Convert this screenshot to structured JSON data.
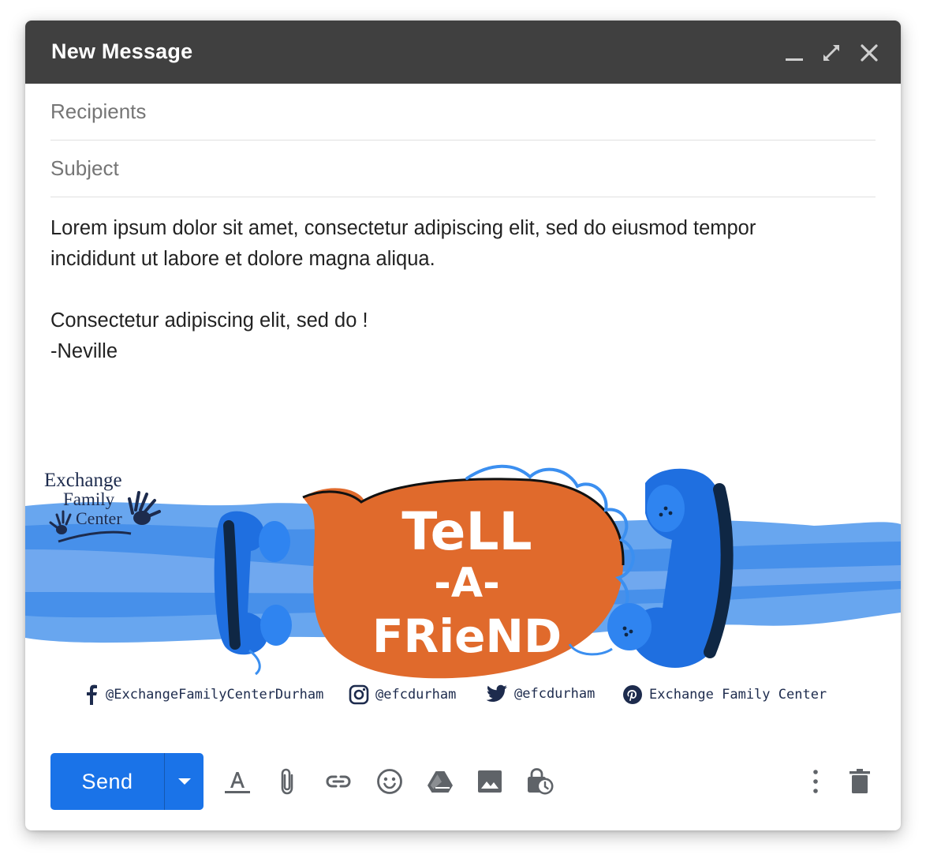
{
  "window": {
    "title": "New Message",
    "controls": [
      "minimize-icon",
      "expand-icon",
      "close-icon"
    ]
  },
  "recipients": {
    "placeholder": "Recipients"
  },
  "subject": {
    "placeholder": "Subject"
  },
  "body": {
    "line1": "Lorem ipsum dolor sit amet, consectetur adipiscing elit, sed do eiusmod tempor",
    "line2": "incididunt ut labore et dolore magna aliqua.",
    "line3": "Consectetur adipiscing elit, sed do !",
    "line4": "-Neville"
  },
  "signature": {
    "logo": {
      "line1": "Exchange",
      "line2": "Family",
      "line3": "Center"
    },
    "banner_text": {
      "line1": "TeLL",
      "line2": "-A-",
      "line3": "FRieND"
    },
    "social": [
      {
        "icon": "facebook-icon",
        "handle": "@ExchangeFamilyCenterDurham"
      },
      {
        "icon": "instagram-icon",
        "handle": "@efcdurham"
      },
      {
        "icon": "twitter-icon",
        "handle": "@efcdurham"
      },
      {
        "icon": "pinterest-icon",
        "handle": "Exchange Family Center"
      }
    ]
  },
  "toolbar": {
    "send_label": "Send",
    "icons": [
      "format-text-icon",
      "attach-icon",
      "link-icon",
      "emoji-icon",
      "drive-icon",
      "image-icon",
      "schedule-lock-icon",
      "more-options-icon",
      "trash-icon"
    ]
  },
  "colors": {
    "titlebar": "#404040",
    "send_button": "#1a73e8",
    "banner_blue": "#3d8ef0",
    "bubble_orange": "#e06a2c",
    "navy": "#1d2b4d"
  }
}
